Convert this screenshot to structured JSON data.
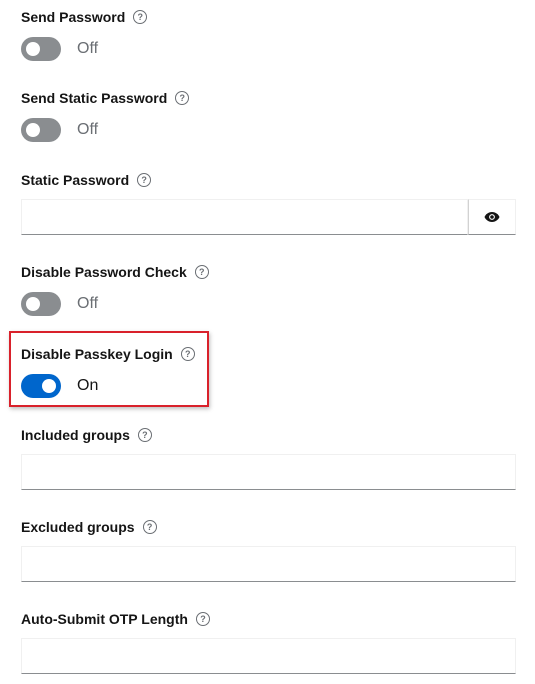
{
  "fields": {
    "send_password": {
      "label": "Send Password",
      "state": "Off"
    },
    "send_static_password": {
      "label": "Send Static Password",
      "state": "Off"
    },
    "static_password": {
      "label": "Static Password",
      "value": ""
    },
    "disable_password_check": {
      "label": "Disable Password Check",
      "state": "Off"
    },
    "disable_passkey_login": {
      "label": "Disable Passkey Login",
      "state": "On"
    },
    "included_groups": {
      "label": "Included groups",
      "value": ""
    },
    "excluded_groups": {
      "label": "Excluded groups",
      "value": ""
    },
    "auto_submit_otp_length": {
      "label": "Auto-Submit OTP Length",
      "value": ""
    }
  },
  "help_glyph": "?",
  "icons": {
    "help": "question-circle-icon",
    "show_password": "eye-icon"
  },
  "colors": {
    "switch_on": "#0066cc",
    "switch_off": "#8a8d90",
    "highlight": "#d9212b"
  }
}
